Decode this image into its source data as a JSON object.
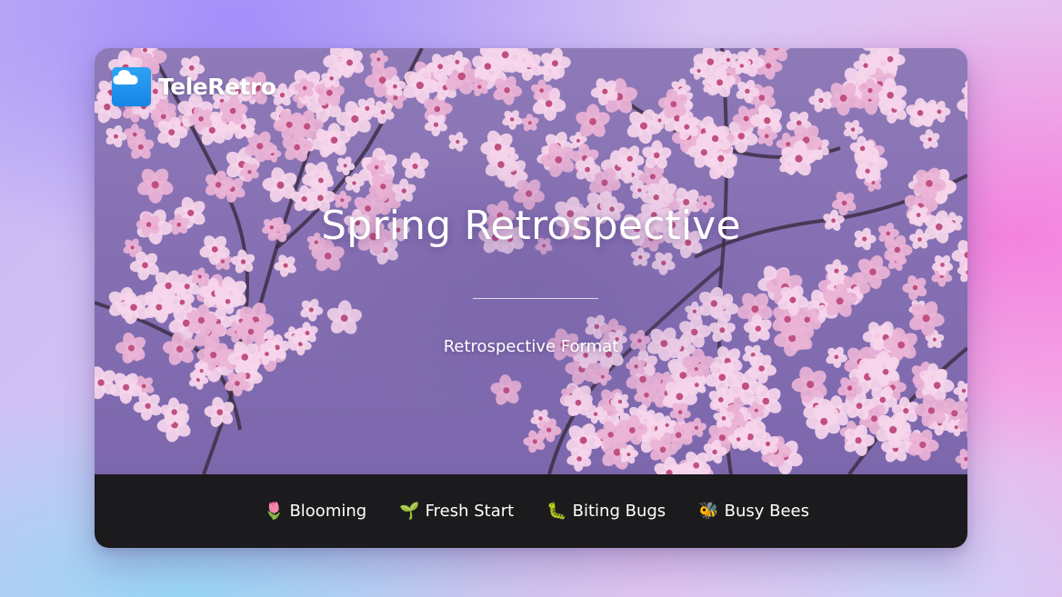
{
  "brand": {
    "name": "TeleRetro",
    "icon": "cloud-icon",
    "color": "#1a8ceb"
  },
  "hero": {
    "title": "Spring Retrospective",
    "subtitle": "Retrospective Format"
  },
  "columns": [
    {
      "emoji": "🌷",
      "label": "Blooming",
      "icon": "tulip-icon"
    },
    {
      "emoji": "🌱",
      "label": "Fresh Start",
      "icon": "seedling-icon"
    },
    {
      "emoji": "🐛",
      "label": "Biting Bugs",
      "icon": "bug-icon"
    },
    {
      "emoji": "🐝",
      "label": "Busy Bees",
      "icon": "bee-icon"
    }
  ],
  "colors": {
    "footer_bg": "#1b1b1d",
    "sky": "#8670b3",
    "blossom": "#f2c6e4",
    "blossom_center": "#c0507f"
  }
}
